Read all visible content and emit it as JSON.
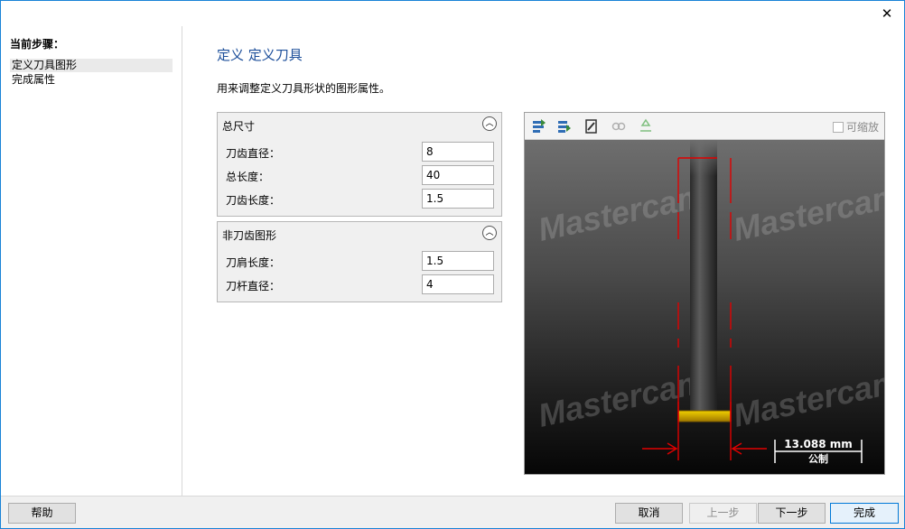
{
  "window": {
    "close_glyph": "✕"
  },
  "sidebar": {
    "title": "当前步骤：",
    "steps": [
      {
        "label": "定义刀具图形",
        "active": true
      },
      {
        "label": "完成属性",
        "active": false
      }
    ]
  },
  "main": {
    "title": "定义 定义刀具",
    "description": "用来调整定义刀具形状的图形属性。"
  },
  "groups": {
    "overall": {
      "title": "总尺寸",
      "fields": [
        {
          "label": "刀齿直径：",
          "value": "8"
        },
        {
          "label": "总长度：",
          "value": "40"
        },
        {
          "label": "刀齿长度：",
          "value": "1.5"
        }
      ]
    },
    "non_cutting": {
      "title": "非刀齿图形",
      "fields": [
        {
          "label": "刀肩长度：",
          "value": "1.5"
        },
        {
          "label": "刀杆直径：",
          "value": "4"
        }
      ]
    }
  },
  "preview": {
    "toolbar_icons": [
      "import-profile-icon",
      "export-profile-icon",
      "edit-tool-icon",
      "chain-icon",
      "recycle-icon"
    ],
    "scalable_label": "可缩放",
    "scalable_checked": false,
    "watermark": "Mastercam",
    "dimension_value": "13.088 mm",
    "dimension_units": "公制",
    "colors": {
      "dimension_line": "#e00000",
      "tool_tip": "#d8b400"
    }
  },
  "footer": {
    "help": "帮助",
    "cancel": "取消",
    "prev": "上一步",
    "next": "下一步",
    "finish": "完成"
  }
}
